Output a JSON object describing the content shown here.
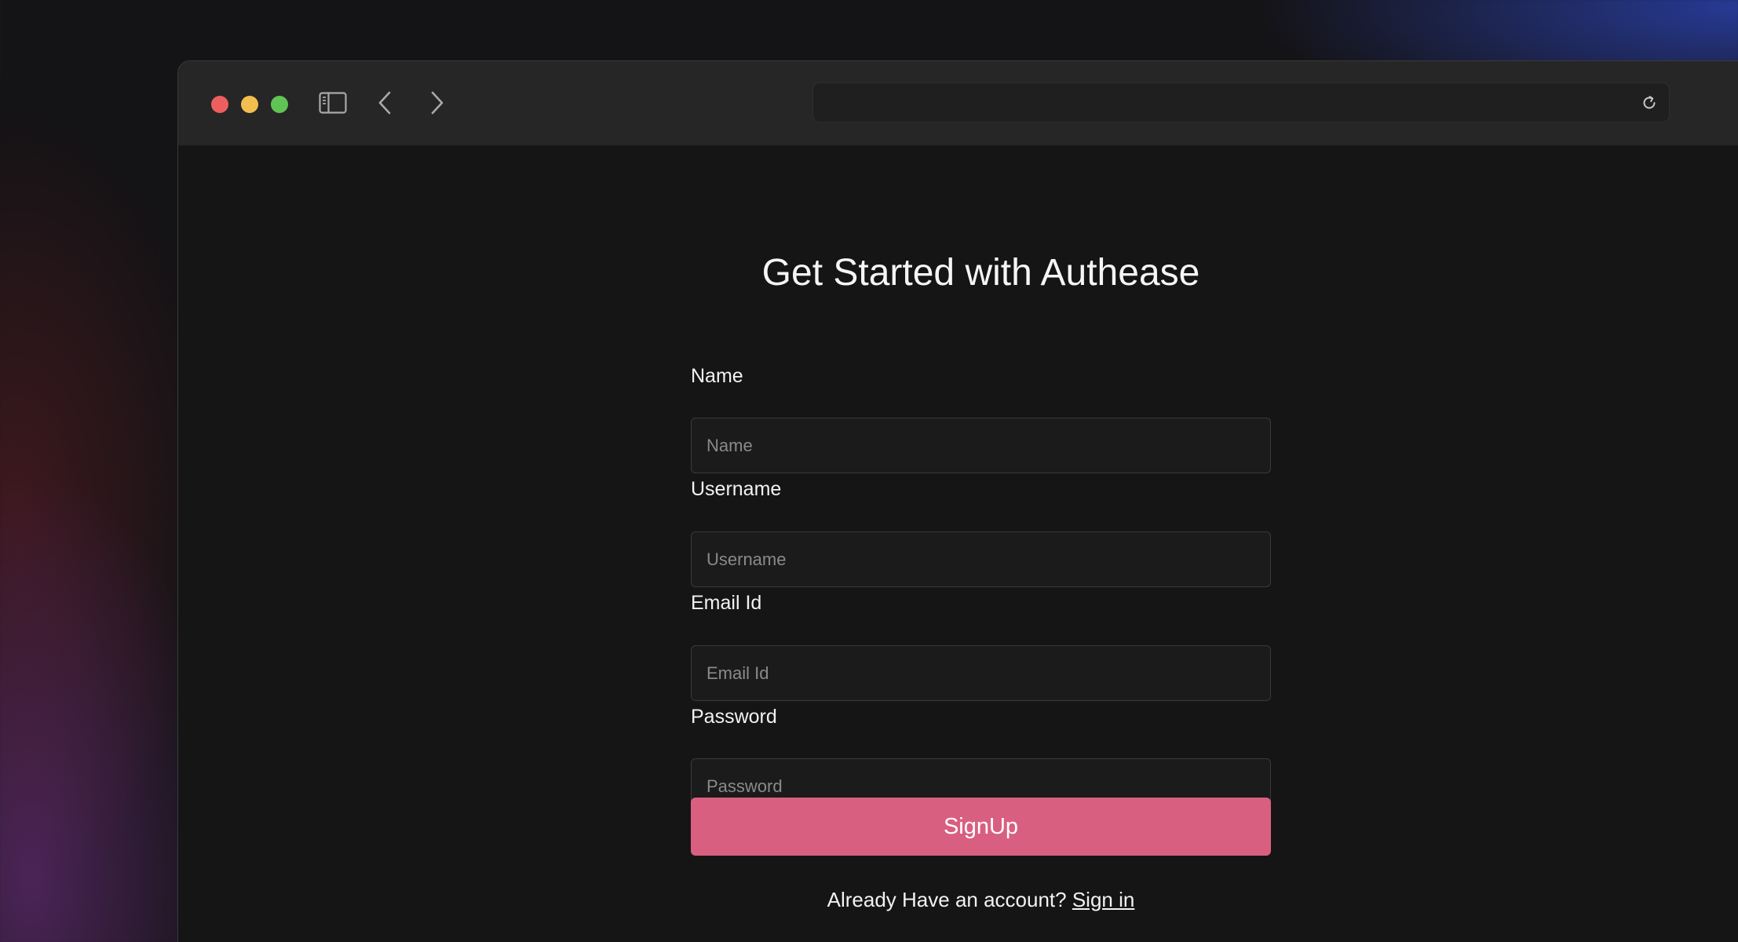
{
  "toolbar": {
    "traffic_lights": {
      "close_color": "#ec5f5e",
      "minimize_color": "#f3be4f",
      "maximize_color": "#5fc454"
    },
    "icons": {
      "sidebar": "sidebar-toggle-icon",
      "back": "chevron-left-icon",
      "forward": "chevron-right-icon",
      "reload": "reload-icon"
    },
    "address_bar": {
      "value": ""
    }
  },
  "signup_form": {
    "title": "Get Started with Authease",
    "fields": [
      {
        "label": "Name",
        "placeholder": "Name",
        "value": ""
      },
      {
        "label": "Username",
        "placeholder": "Username",
        "value": ""
      },
      {
        "label": "Email Id",
        "placeholder": "Email Id",
        "value": ""
      },
      {
        "label": "Password",
        "placeholder": "Password",
        "value": ""
      }
    ],
    "submit_label": "SignUp",
    "submit_color": "#d95f81",
    "signin_prompt": "Already Have an account?",
    "signin_link": "Sign in"
  }
}
